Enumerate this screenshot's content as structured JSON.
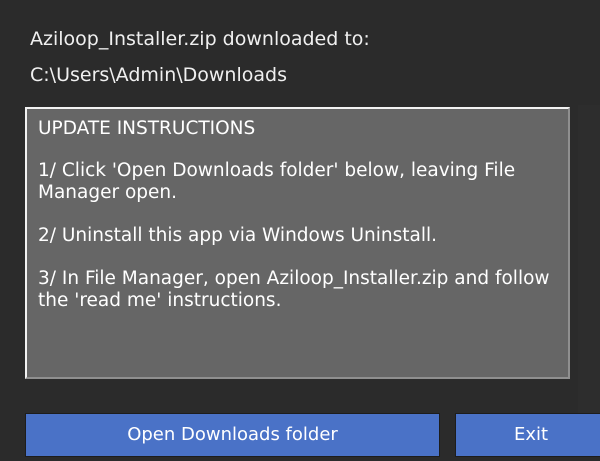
{
  "dialog": {
    "downloaded_label": "Aziloop_Installer.zip downloaded to:",
    "download_path": "C:\\Users\\Admin\\Downloads"
  },
  "instructions": {
    "heading": "UPDATE INSTRUCTIONS",
    "steps": [
      "1/ Click 'Open Downloads folder' below, leaving File Manager open.",
      "2/ Uninstall this app via Windows Uninstall.",
      "3/ In File Manager, open Aziloop_Installer.zip and follow the 'read me' instructions."
    ]
  },
  "actions": {
    "open_downloads_label": "Open Downloads folder",
    "exit_label": "Exit"
  },
  "colors": {
    "window_background": "#2b2b2b",
    "instructions_background": "#666666",
    "button_blue": "#4a72c7",
    "text": "#ffffff"
  }
}
